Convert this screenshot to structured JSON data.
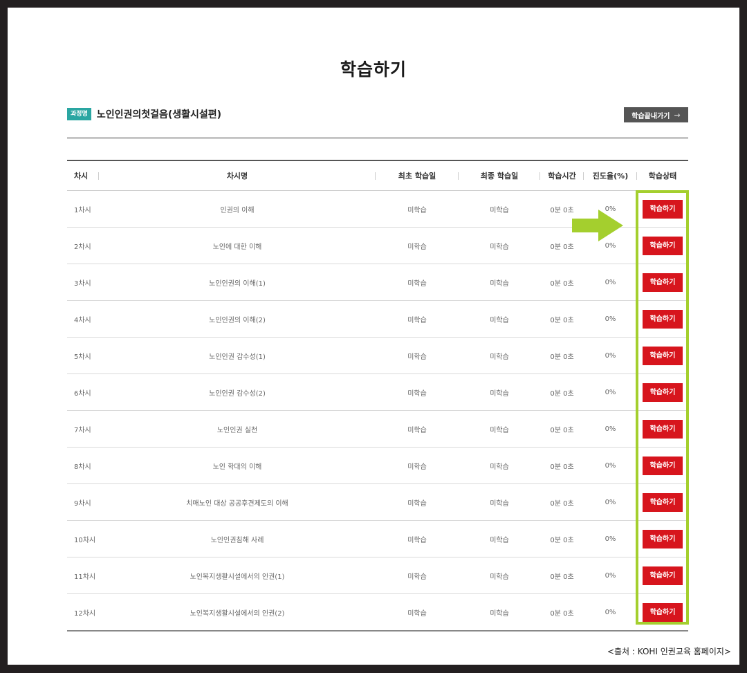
{
  "page": {
    "title": "학습하기"
  },
  "course": {
    "badge": "과정명",
    "name": "노인인권의첫걸음(생활시설편)",
    "exit_label": "학습끝내가기",
    "exit_arrow": "→"
  },
  "table": {
    "headers": {
      "session": "차시",
      "name": "차시명",
      "first_date": "최초 학습일",
      "last_date": "최종 학습일",
      "time": "학습시간",
      "progress": "진도율(%)",
      "status": "학습상태"
    },
    "rows": [
      {
        "session": "1차시",
        "name": "인권의 이해",
        "first": "미학습",
        "last": "미학습",
        "time": "0분 0초",
        "progress": "0%",
        "button": "학습하기"
      },
      {
        "session": "2차시",
        "name": "노인에 대한 이해",
        "first": "미학습",
        "last": "미학습",
        "time": "0분 0초",
        "progress": "0%",
        "button": "학습하기"
      },
      {
        "session": "3차시",
        "name": "노인인권의 이해(1)",
        "first": "미학습",
        "last": "미학습",
        "time": "0분 0초",
        "progress": "0%",
        "button": "학습하기"
      },
      {
        "session": "4차시",
        "name": "노인인권의 이해(2)",
        "first": "미학습",
        "last": "미학습",
        "time": "0분 0초",
        "progress": "0%",
        "button": "학습하기"
      },
      {
        "session": "5차시",
        "name": "노인인권 감수성(1)",
        "first": "미학습",
        "last": "미학습",
        "time": "0분 0초",
        "progress": "0%",
        "button": "학습하기"
      },
      {
        "session": "6차시",
        "name": "노인인권 감수성(2)",
        "first": "미학습",
        "last": "미학습",
        "time": "0분 0초",
        "progress": "0%",
        "button": "학습하기"
      },
      {
        "session": "7차시",
        "name": "노인인권 실천",
        "first": "미학습",
        "last": "미학습",
        "time": "0분 0초",
        "progress": "0%",
        "button": "학습하기"
      },
      {
        "session": "8차시",
        "name": "노인 학대의 이해",
        "first": "미학습",
        "last": "미학습",
        "time": "0분 0초",
        "progress": "0%",
        "button": "학습하기"
      },
      {
        "session": "9차시",
        "name": "치매노인 대상 공공후견제도의 이해",
        "first": "미학습",
        "last": "미학습",
        "time": "0분 0초",
        "progress": "0%",
        "button": "학습하기"
      },
      {
        "session": "10차시",
        "name": "노인인권침해 사례",
        "first": "미학습",
        "last": "미학습",
        "time": "0분 0초",
        "progress": "0%",
        "button": "학습하기"
      },
      {
        "session": "11차시",
        "name": "노인복지생활시설에서의 인권(1)",
        "first": "미학습",
        "last": "미학습",
        "time": "0분 0초",
        "progress": "0%",
        "button": "학습하기"
      },
      {
        "session": "12차시",
        "name": "노인복지생활시설에서의 인권(2)",
        "first": "미학습",
        "last": "미학습",
        "time": "0분 0초",
        "progress": "0%",
        "button": "학습하기"
      }
    ]
  },
  "annotation": {
    "icon": "arrow-right-icon",
    "arrow_color": "#a4cf2e",
    "highlight_color": "#a4cf2e"
  },
  "source": "<출처 : KOHI 인권교육 홈페이지>",
  "colors": {
    "badge": "#2aa6a2",
    "study_button": "#d7151d",
    "exit_button": "#555555"
  }
}
